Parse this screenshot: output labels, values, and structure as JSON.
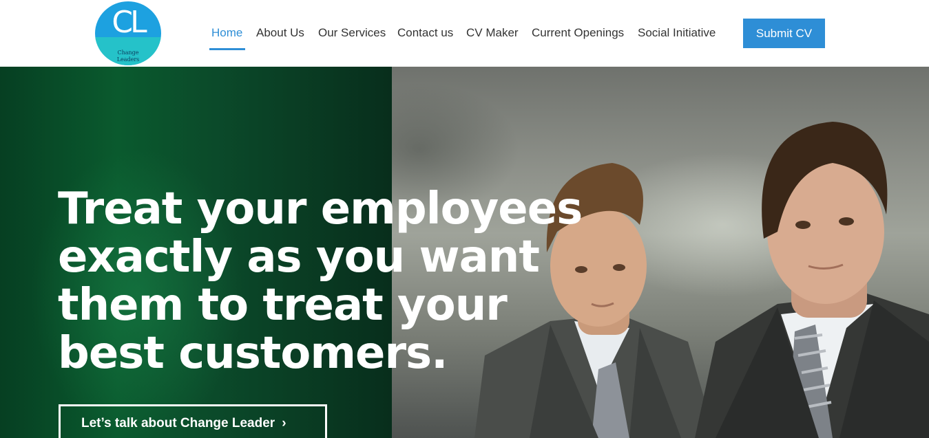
{
  "brand": {
    "logo_letters": "CL",
    "logo_subtitle_line1": "Change",
    "logo_subtitle_line2": "Leaders",
    "colors": {
      "logo_blue": "#1da1e0",
      "logo_teal": "#25c2c9",
      "accent": "#2e8ed6"
    }
  },
  "nav": {
    "items": [
      {
        "label": "Home",
        "active": true
      },
      {
        "label": "About Us",
        "active": false
      },
      {
        "label": "Our Services",
        "active": false
      },
      {
        "label": "Contact us",
        "active": false
      },
      {
        "label": "CV Maker",
        "active": false
      },
      {
        "label": "Current Openings",
        "active": false
      },
      {
        "label": "Social Initiative",
        "active": false
      }
    ],
    "cta_label": "Submit CV"
  },
  "hero": {
    "headline_lines": [
      "Treat your employees",
      "exactly as you want",
      "them to treat your",
      "best customers."
    ],
    "button_label": "Let’s talk about Change Leader",
    "button_icon": "chevron-right-icon",
    "image": "two-businessmen-in-suits"
  }
}
